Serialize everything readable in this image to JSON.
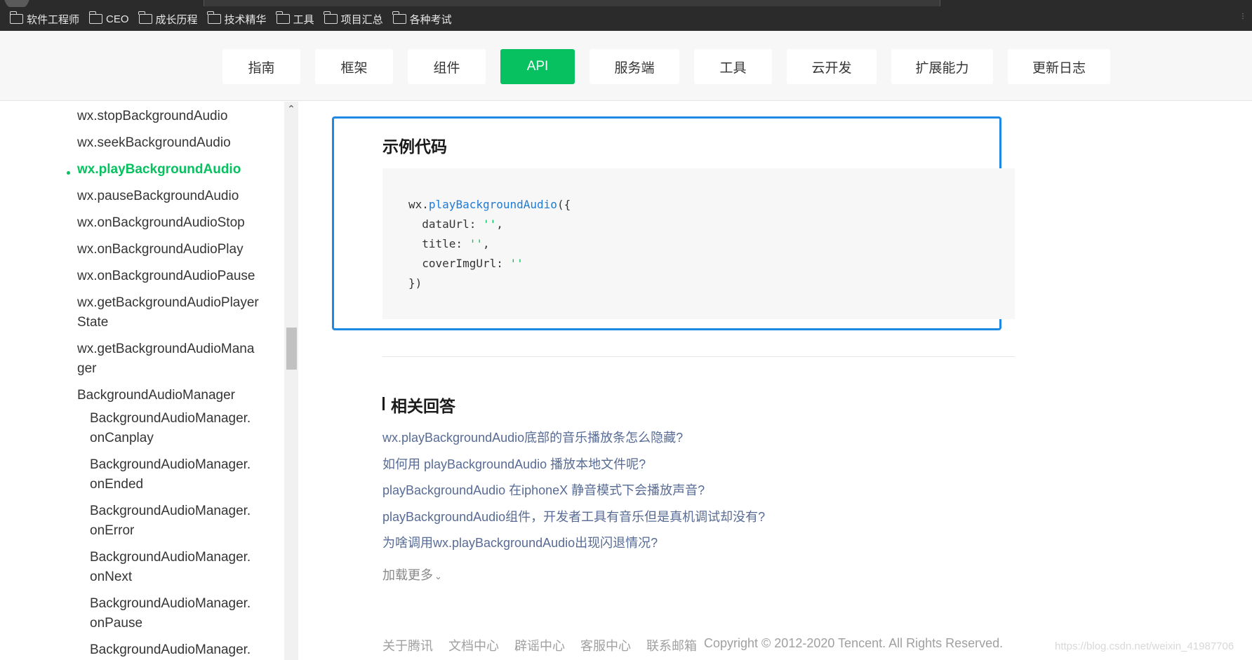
{
  "bookmarks": [
    {
      "label": "软件工程师"
    },
    {
      "label": "CEO"
    },
    {
      "label": "成长历程"
    },
    {
      "label": "技术精华"
    },
    {
      "label": "工具"
    },
    {
      "label": "项目汇总"
    },
    {
      "label": "各种考试"
    }
  ],
  "nav": {
    "items": [
      {
        "label": "指南"
      },
      {
        "label": "框架"
      },
      {
        "label": "组件"
      },
      {
        "label": "API"
      },
      {
        "label": "服务端"
      },
      {
        "label": "工具"
      },
      {
        "label": "云开发"
      },
      {
        "label": "扩展能力"
      },
      {
        "label": "更新日志"
      }
    ],
    "active": "API"
  },
  "sidebar": {
    "items": [
      {
        "label": "wx.stopBackgroundAudio"
      },
      {
        "label": "wx.seekBackgroundAudio"
      },
      {
        "label": "wx.playBackgroundAudio"
      },
      {
        "label": "wx.pauseBackgroundAudio"
      },
      {
        "label": "wx.onBackgroundAudioStop"
      },
      {
        "label": "wx.onBackgroundAudioPlay"
      },
      {
        "label": "wx.onBackgroundAudioPause"
      },
      {
        "label": "wx.getBackgroundAudioPlayer"
      },
      {
        "label": "State"
      },
      {
        "label": "wx.getBackgroundAudioMana"
      },
      {
        "label": "ger"
      },
      {
        "label": "BackgroundAudioManager"
      },
      {
        "label": "BackgroundAudioManager."
      },
      {
        "label": "onCanplay"
      },
      {
        "label": "BackgroundAudioManager."
      },
      {
        "label": "onEnded"
      },
      {
        "label": "BackgroundAudioManager."
      },
      {
        "label": "onError"
      },
      {
        "label": "BackgroundAudioManager."
      },
      {
        "label": "onNext"
      },
      {
        "label": "BackgroundAudioManager."
      },
      {
        "label": "onPause"
      },
      {
        "label": "BackgroundAudioManager."
      }
    ],
    "active": "wx.playBackgroundAudio"
  },
  "example": {
    "title": "示例代码",
    "code": {
      "l1_obj": "wx.",
      "l1_fn": "playBackgroundAudio",
      "l1_end": "({",
      "l2_key": "  dataUrl: ",
      "l2_val": "''",
      "l2_end": ",",
      "l3_key": "  title: ",
      "l3_val": "''",
      "l3_end": ",",
      "l4_key": "  coverImgUrl: ",
      "l4_val": "''",
      "l5": "})"
    }
  },
  "answers": {
    "title": "相关回答",
    "links": [
      {
        "label": "wx.playBackgroundAudio底部的音乐播放条怎么隐藏?"
      },
      {
        "label": "如何用 playBackgroundAudio 播放本地文件呢?"
      },
      {
        "label": "playBackgroundAudio 在iphoneX 静音模式下会播放声音?"
      },
      {
        "label": "playBackgroundAudio组件，开发者工具有音乐但是真机调试却没有?"
      },
      {
        "label": "为啥调用wx.playBackgroundAudio出现闪退情况?"
      }
    ],
    "load_more": "加载更多"
  },
  "footer": {
    "links": [
      {
        "label": "关于腾讯"
      },
      {
        "label": "文档中心"
      },
      {
        "label": "辟谣中心"
      },
      {
        "label": "客服中心"
      },
      {
        "label": "联系邮箱"
      }
    ],
    "copyright": "Copyright © 2012-2020 Tencent. All Rights Reserved."
  },
  "watermark": "https://blog.csdn.net/weixin_41987706",
  "colors": {
    "accent": "#07c160",
    "link": "#576b95",
    "highlight_border": "#1e88e5"
  }
}
